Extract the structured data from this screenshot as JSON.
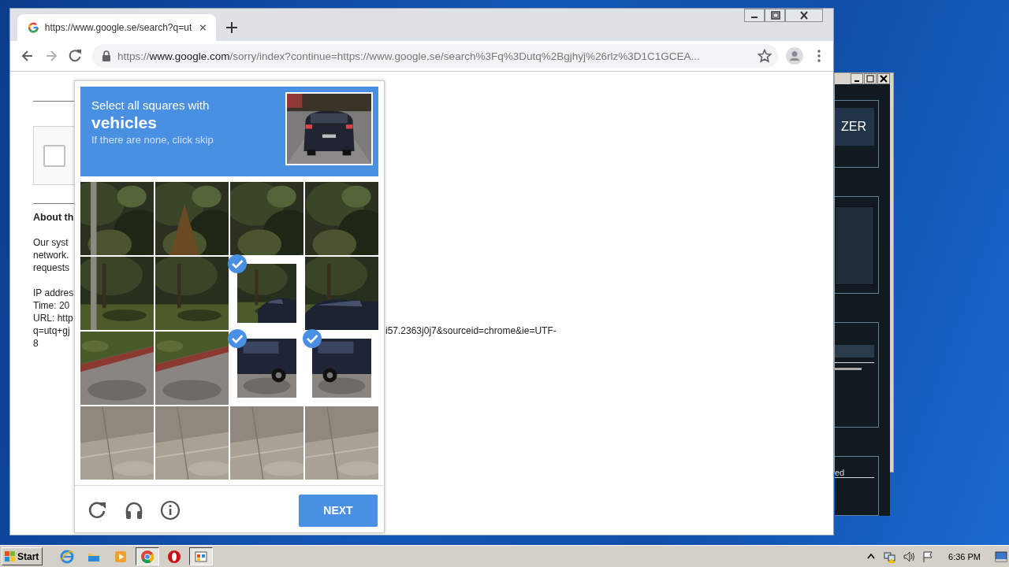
{
  "browser": {
    "window_controls": [
      {
        "kind": "minimize"
      },
      {
        "kind": "restore"
      },
      {
        "kind": "close"
      }
    ],
    "tabs": [
      {
        "title": "https://www.google.se/search?q=ut",
        "selected": true
      }
    ],
    "nav": [
      {
        "kind": "back",
        "disabled": false
      },
      {
        "kind": "forward",
        "disabled": true
      },
      {
        "kind": "reload",
        "disabled": false
      }
    ],
    "address": {
      "scheme": "https://",
      "host": "www.google.com",
      "rest": "/sorry/index?continue=https://www.google.se/search%3Fq%3Dutq%2Bgjhyj%26rlz%3D1C1GCEA..."
    }
  },
  "page": {
    "anchor_checkbox": {
      "checked": false
    },
    "heading": "About th",
    "paragraph": [
      "Our syst",
      "network.",
      "requests"
    ],
    "lines": [
      "IP addres",
      "Time: 20",
      "URL: http"
    ],
    "url_line": {
      "left": "q=utq+gj",
      "right": "i57.2363j0j7&sourceid=chrome&ie=UTF-"
    },
    "last_line": "8"
  },
  "captcha": {
    "instruction": "Select all squares with",
    "target": "vehicles",
    "hint": "If there are none, click skip",
    "tiles": [
      {
        "selected": false
      },
      {
        "selected": false
      },
      {
        "selected": false
      },
      {
        "selected": false
      },
      {
        "selected": false
      },
      {
        "selected": false
      },
      {
        "selected": true
      },
      {
        "selected": false
      },
      {
        "selected": false
      },
      {
        "selected": false
      },
      {
        "selected": true
      },
      {
        "selected": true
      },
      {
        "selected": false
      },
      {
        "selected": false
      },
      {
        "selected": false
      },
      {
        "selected": false
      }
    ],
    "footer_icons": [
      {
        "kind": "reload"
      },
      {
        "kind": "audio"
      },
      {
        "kind": "info"
      }
    ],
    "button": "NEXT"
  },
  "background_app": {
    "button": "ZER",
    "label": "ed"
  },
  "taskbar": {
    "start": "Start",
    "apps": [
      {
        "kind": "ie",
        "selected": false
      },
      {
        "kind": "folder",
        "selected": false
      },
      {
        "kind": "media",
        "selected": false
      },
      {
        "kind": "chrome",
        "selected": true
      },
      {
        "kind": "opera",
        "selected": false
      },
      {
        "kind": "app",
        "selected": true
      }
    ],
    "tray": [
      {
        "kind": "arrow"
      },
      {
        "kind": "network"
      },
      {
        "kind": "volume"
      },
      {
        "kind": "flag"
      }
    ],
    "clock": "6:36 PM"
  }
}
